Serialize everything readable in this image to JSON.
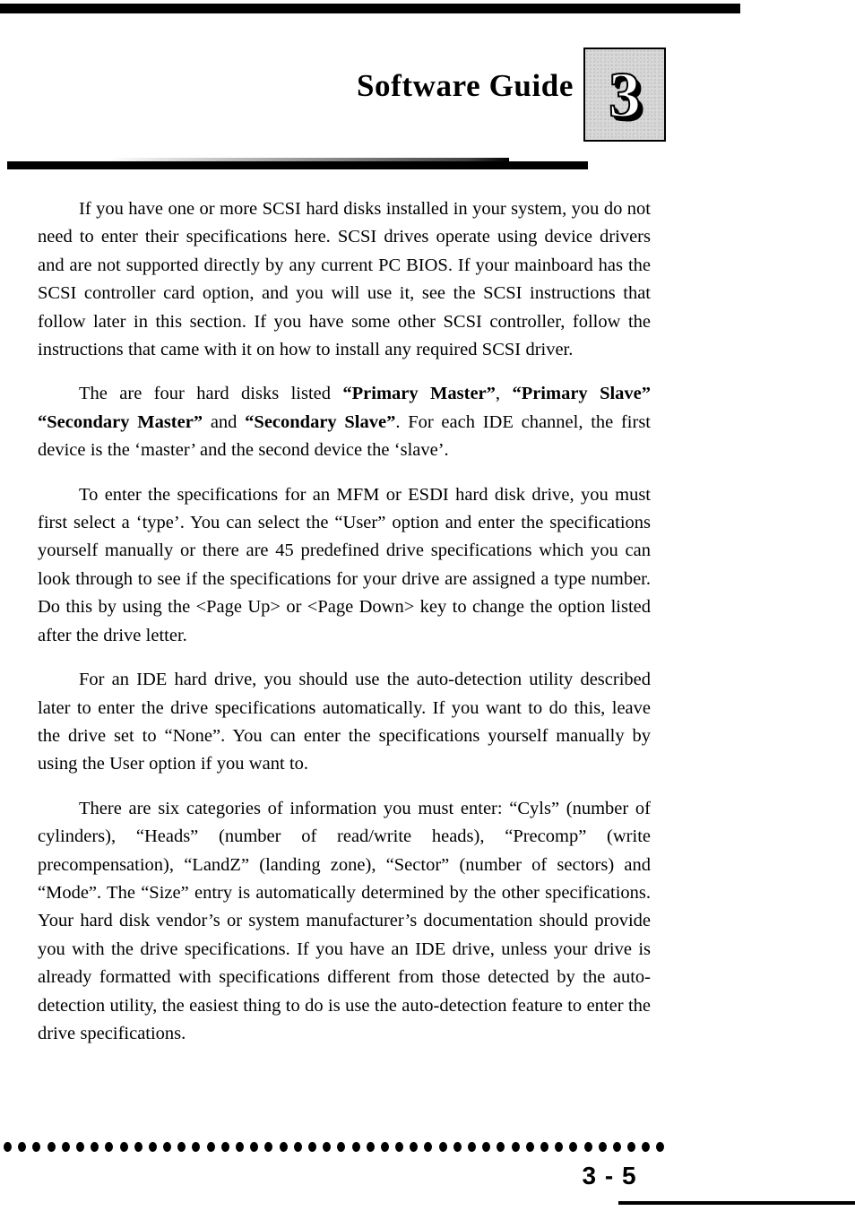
{
  "document": {
    "header": {
      "title": "Software Guide",
      "chapter_number": "3"
    },
    "body": {
      "paragraphs": [
        {
          "id": "scsi-hard-disks",
          "runs": [
            {
              "text": "If you have one or more SCSI hard disks installed in your system, you do not need to enter their specifications here. SCSI drives operate using device drivers and are not supported directly by any current PC BIOS. If your mainboard has the SCSI controller card option, and you will use it, see the SCSI instructions that follow later in this section. If you have some other SCSI controller, follow the instructions that came with it on how to install any required SCSI driver.",
              "bold": false
            }
          ]
        },
        {
          "id": "four-hard-disks-listed",
          "runs": [
            {
              "text": "The are four hard disks listed ",
              "bold": false
            },
            {
              "text": "“Primary Master”",
              "bold": true
            },
            {
              "text": ", ",
              "bold": false
            },
            {
              "text": "“Primary Slave” “Secondary Master”",
              "bold": true
            },
            {
              "text": " and ",
              "bold": false
            },
            {
              "text": "“Secondary Slave”",
              "bold": true
            },
            {
              "text": ". For each IDE channel, the first device is the ‘master’ and the second device the ‘slave’.",
              "bold": false
            }
          ]
        },
        {
          "id": "mfm-esdi-drive-type",
          "runs": [
            {
              "text": "To enter the specifications for an MFM or ESDI hard disk drive, you must first select a ‘type’. You can select the  “User” option and enter the specifications yourself manually or there are 45 predefined drive specifications which you can look through to see if the specifications for your drive are assigned a type number. Do this by using the <Page Up> or <Page Down> key to change the option listed after the drive letter.",
              "bold": false
            }
          ]
        },
        {
          "id": "ide-auto-detection",
          "runs": [
            {
              "text": "For an IDE hard drive, you should use the auto-detection utility described later to enter the drive specifications automatically. If you want to do this, leave the drive set to “None”. You can enter the specifications yourself manually by using the User option if you want to.",
              "bold": false
            }
          ]
        },
        {
          "id": "six-categories",
          "runs": [
            {
              "text": "There are six categories of information you must enter: “Cyls” (number of cylinders), “Heads” (number of read/write heads), “Precomp” (write precompensation), “LandZ” (landing zone), “Sector” (number of sectors) and “Mode”. The “Size” entry is automatically determined by the other specifications. Your hard disk vendor’s or system manufacturer’s documentation should provide you with the drive specifications. If you have an IDE drive, unless your drive is already formatted with specifications different from those detected by the auto-detection utility, the easiest thing to do is use the auto-detection feature to enter the drive specifications.",
              "bold": false
            }
          ]
        }
      ]
    },
    "footer": {
      "page_number": "3 - 5",
      "dot_count": 46
    },
    "colors": {
      "ink": "#000000",
      "paper": "#ffffff",
      "chapter_box_fill": "#d8d8d8"
    }
  }
}
